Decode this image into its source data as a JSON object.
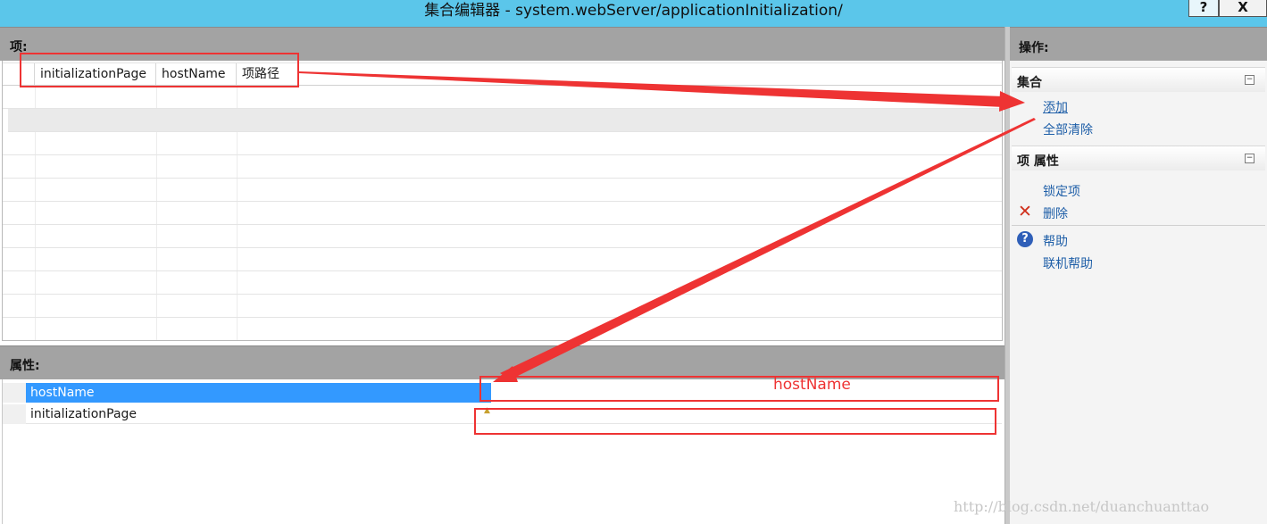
{
  "window": {
    "title": "集合编辑器 - system.webServer/applicationInitialization/",
    "help_glyph": "?",
    "close_glyph": "X"
  },
  "items_panel": {
    "header": "项:",
    "columns": [
      "",
      "initializationPage",
      "hostName",
      "项路径"
    ]
  },
  "properties_panel": {
    "header": "属性:",
    "rows": [
      {
        "name": "hostName",
        "value": "",
        "selected": true
      },
      {
        "name": "initializationPage",
        "value": "",
        "selected": false
      }
    ]
  },
  "actions_panel": {
    "header": "操作:",
    "groups": [
      {
        "title": "集合",
        "toggle": "⊟",
        "items": [
          "添加",
          "全部清除"
        ]
      },
      {
        "title": "项 属性",
        "toggle": "⊟",
        "items": [
          "锁定项",
          "删除",
          "帮助",
          "联机帮助"
        ]
      }
    ]
  },
  "annotation": {
    "label": "hostName",
    "color": "#ee3333"
  },
  "watermark": "http://blog.csdn.net/duanchuanttao",
  "colors": {
    "titlebar": "#5bc6ea",
    "section_header": "#a3a3a3",
    "selection": "#3399ff",
    "link": "#1f5fa8"
  }
}
